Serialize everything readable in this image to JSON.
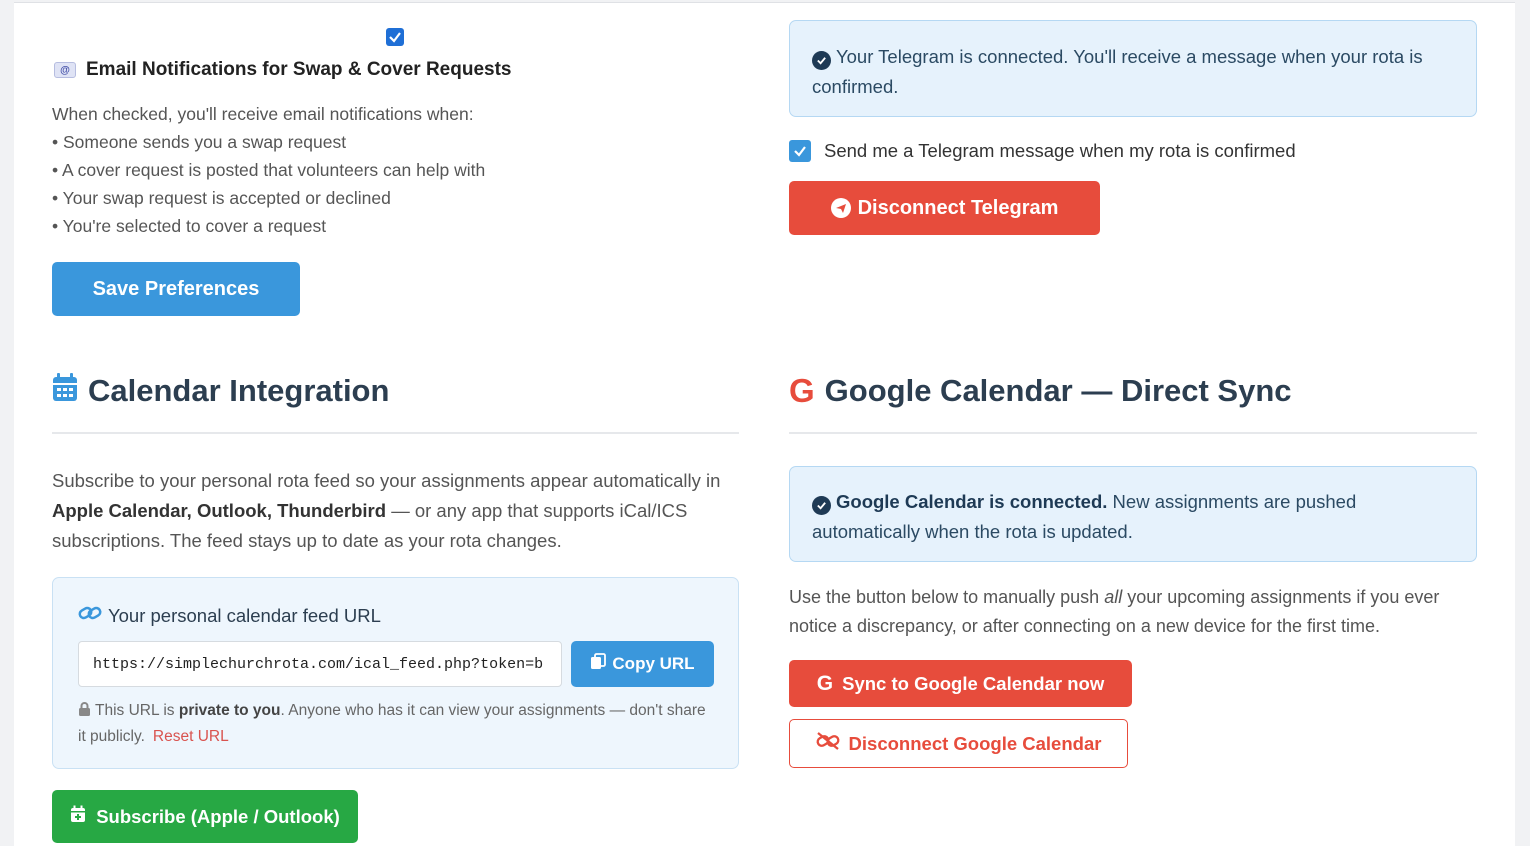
{
  "email_prefs": {
    "checkbox_checked": true,
    "heading": "Email Notifications for Swap & Cover Requests",
    "intro": "When checked, you'll receive email notifications when:",
    "bullets": [
      "• Someone sends you a swap request",
      "• A cover request is posted that volunteers can help with",
      "• Your swap request is accepted or declined",
      "• You're selected to cover a request"
    ],
    "save_label": "Save Preferences"
  },
  "telegram": {
    "status_text": "Your Telegram is connected. You'll receive a message when your rota is confirmed.",
    "notify_label": "Send me a Telegram message when my rota is confirmed",
    "notify_checked": true,
    "disconnect_label": "Disconnect Telegram"
  },
  "calendar": {
    "title": "Calendar Integration",
    "desc_before": "Subscribe to your personal rota feed so your assignments appear automatically in ",
    "desc_bold": "Apple Calendar, Outlook, Thunderbird",
    "desc_after": " — or any app that supports iCal/ICS subscriptions. The feed stays up to date as your rota changes.",
    "feed_title": "Your personal calendar feed URL",
    "feed_url": "https://simplechurchrota.com/ical_feed.php?token=b",
    "copy_label": "Copy URL",
    "note_before": " This URL is ",
    "note_bold": "private to you",
    "note_after": ". Anyone who has it can view your assignments — don't share it publicly.",
    "reset_label": "Reset URL",
    "subscribe_label": "Subscribe (Apple / Outlook)"
  },
  "google": {
    "title": "Google Calendar — Direct Sync",
    "status_bold": "Google Calendar is connected.",
    "status_rest": " New assignments are pushed automatically when the rota is updated.",
    "desc_before": "Use the button below to manually push ",
    "desc_italic": "all",
    "desc_after": " your upcoming assignments if you ever notice a discrepancy, or after connecting on a new device for the first time.",
    "sync_label": "Sync to Google Calendar now",
    "disconnect_label": "Disconnect Google Calendar"
  },
  "colors": {
    "primary": "#3a97dc",
    "danger": "#e74c3c",
    "success": "#27a844",
    "heading": "#2c3e50"
  }
}
